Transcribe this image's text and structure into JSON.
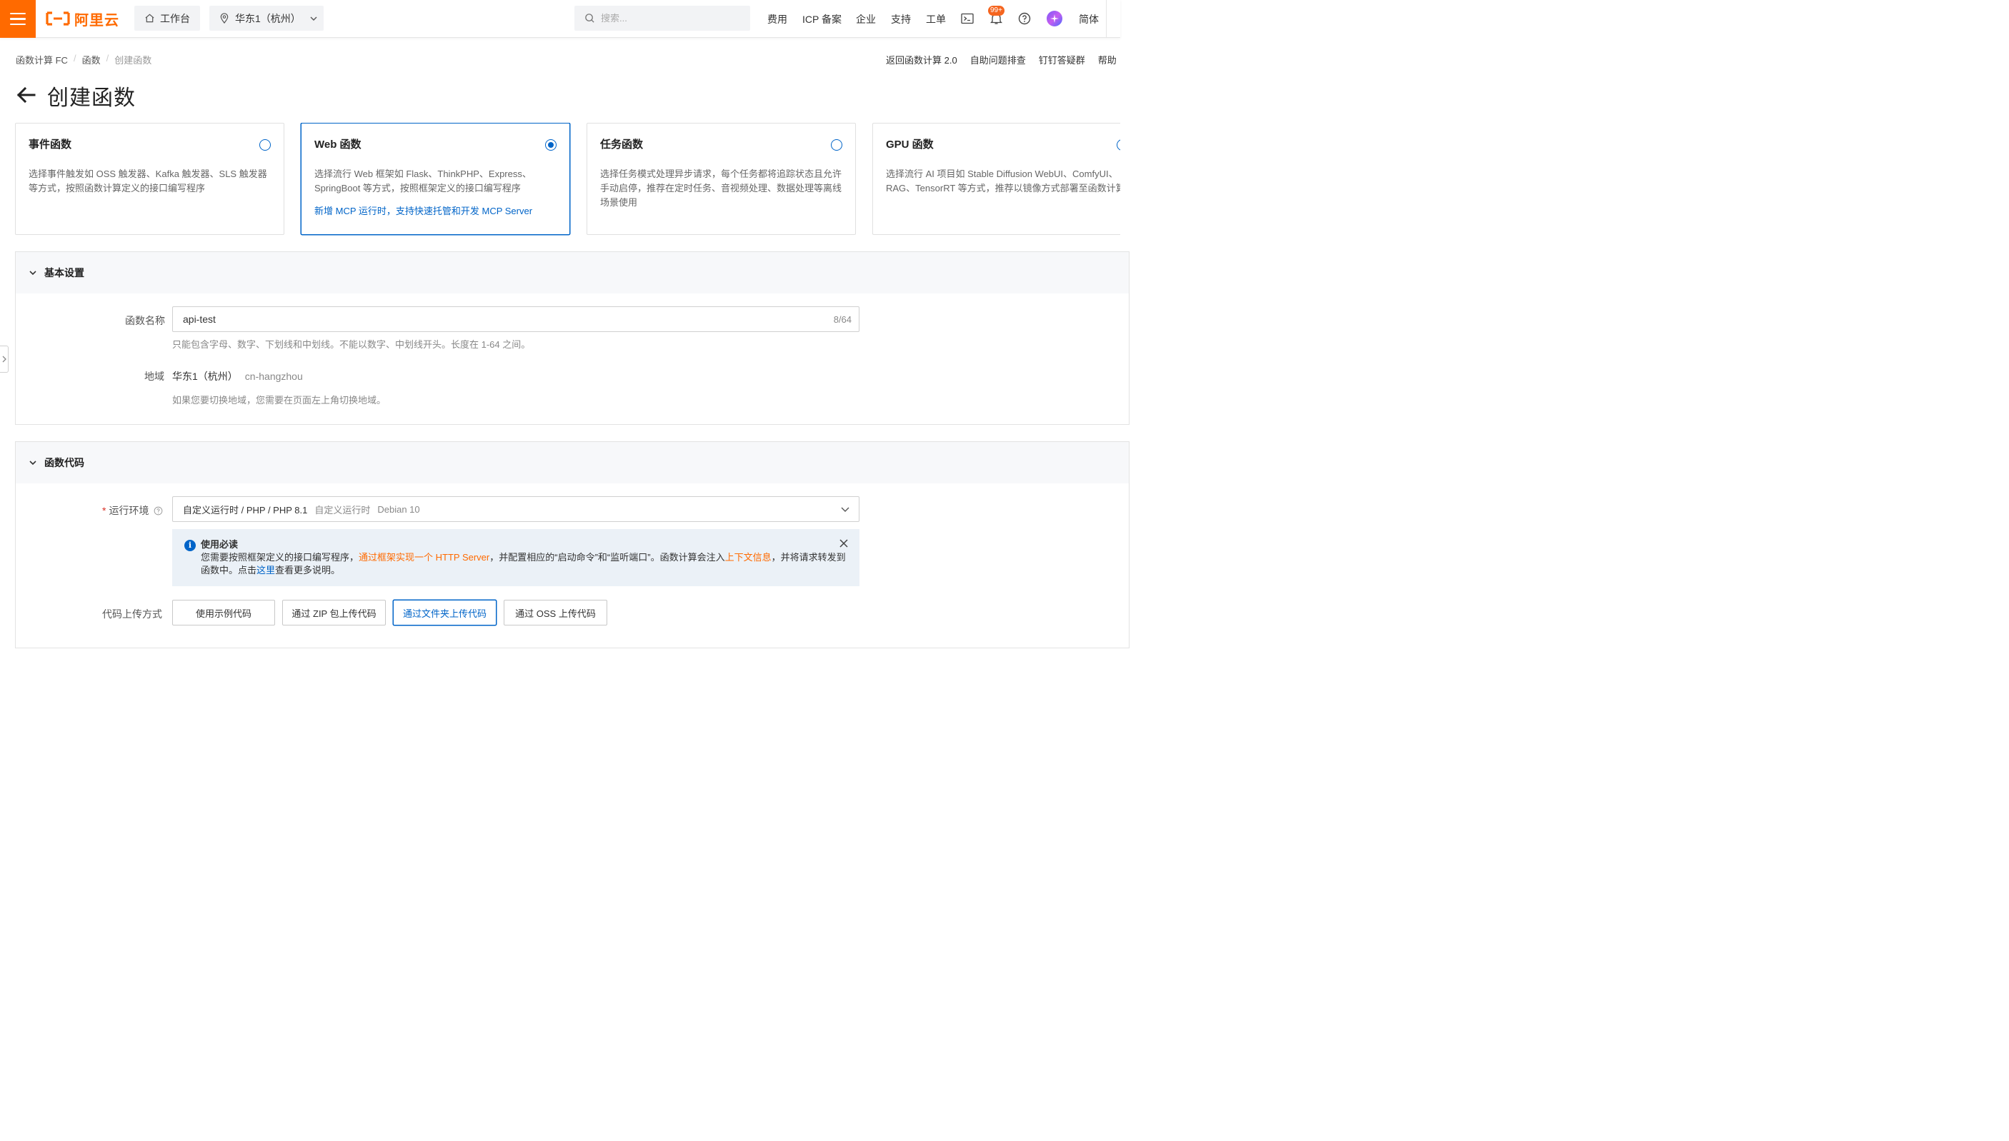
{
  "brand": {
    "logo_text": "阿里云",
    "accent": "#ff6a00",
    "primary": "#0064c8"
  },
  "topbar": {
    "workbench_label": "工作台",
    "region_label": "华东1（杭州）",
    "search_placeholder": "搜索...",
    "links": {
      "fees": "费用",
      "icp": "ICP 备案",
      "enterprise": "企业",
      "support": "支持",
      "ticket": "工单",
      "lang": "简体"
    },
    "notification_badge": "99+"
  },
  "breadcrumb": {
    "root": "函数计算 FC",
    "level2": "函数",
    "current": "创建函数"
  },
  "help_links": {
    "back_v2": "返回函数计算 2.0",
    "self_help": "自助问题排查",
    "dingtalk": "钉钉答疑群",
    "help": "帮助"
  },
  "page_title": "创建函数",
  "function_types": [
    {
      "title": "事件函数",
      "desc": "选择事件触发如 OSS 触发器、Kafka 触发器、SLS 触发器等方式，按照函数计算定义的接口编写程序",
      "note": "",
      "selected": false
    },
    {
      "title": "Web 函数",
      "desc": "选择流行 Web 框架如 Flask、ThinkPHP、Express、SpringBoot 等方式，按照框架定义的接口编写程序",
      "note": "新增 MCP 运行时，支持快速托管和开发 MCP Server",
      "selected": true
    },
    {
      "title": "任务函数",
      "desc": "选择任务模式处理异步请求，每个任务都将追踪状态且允许手动启停，推荐在定时任务、音视频处理、数据处理等离线场景使用",
      "note": "",
      "selected": false
    },
    {
      "title": "GPU 函数",
      "desc": "选择流行 AI 项目如 Stable Diffusion WebUI、ComfyUI、RAG、TensorRT 等方式，推荐以镜像方式部署至函数计算",
      "note": "",
      "selected": false
    }
  ],
  "basic_settings": {
    "title": "基本设置",
    "name_label": "函数名称",
    "name_value": "api-test",
    "name_count": "8/64",
    "name_hint": "只能包含字母、数字、下划线和中划线。不能以数字、中划线开头。长度在 1-64 之间。",
    "region_label": "地域",
    "region_value": "华东1（杭州）",
    "region_code": "cn-hangzhou",
    "region_hint": "如果您要切换地域，您需要在页面左上角切换地域。"
  },
  "function_code": {
    "title": "函数代码",
    "runtime_required_mark": "*",
    "runtime_label": "运行环境",
    "runtime_value": "自定义运行时 / PHP / PHP 8.1",
    "runtime_sub1": "自定义运行时",
    "runtime_sub2": "Debian 10",
    "notice": {
      "title": "使用必读",
      "text_before": "您需要按照框架定义的接口编写程序，",
      "link1": "通过框架实现一个 HTTP Server",
      "text_mid": "，并配置相应的“启动命令”和“监听端口”。函数计算会注入",
      "link2": "上下文信息",
      "text_after": "，并将请求转发到函数中。点击",
      "link3": "这里",
      "text_end": "查看更多说明。"
    },
    "upload_label": "代码上传方式",
    "upload_options": [
      "使用示例代码",
      "通过 ZIP 包上传代码",
      "通过文件夹上传代码",
      "通过 OSS 上传代码"
    ],
    "upload_selected_index": 2
  }
}
